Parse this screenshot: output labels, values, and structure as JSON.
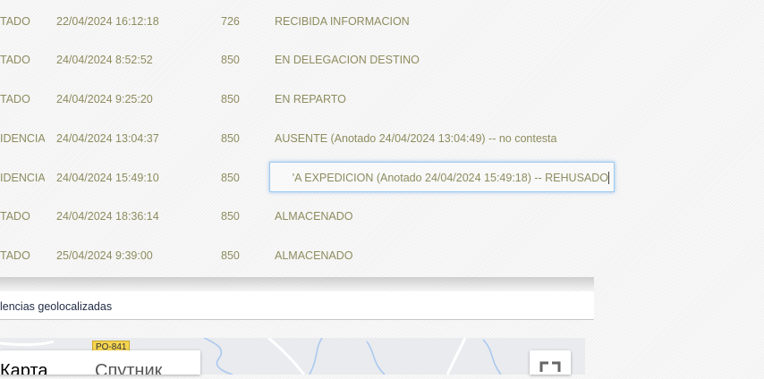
{
  "events": [
    {
      "status": "TADO",
      "date": "22/04/2024 16:12:18",
      "code": "726",
      "description": "RECIBIDA INFORMACION"
    },
    {
      "status": "TADO",
      "date": "24/04/2024 8:52:52",
      "code": "850",
      "description": "EN DELEGACION DESTINO"
    },
    {
      "status": "TADO",
      "date": "24/04/2024 9:25:20",
      "code": "850",
      "description": "EN REPARTO"
    },
    {
      "status": "IDENCIA",
      "date": "24/04/2024 13:04:37",
      "code": "850",
      "description": "AUSENTE (Anotado 24/04/2024 13:04:49) -- no contesta"
    },
    {
      "status": "IDENCIA",
      "date": "24/04/2024 15:49:10",
      "code": "850",
      "description": "'A EXPEDICION (Anotado 24/04/2024 15:49:18) -- REHUSADO"
    },
    {
      "status": "TADO",
      "date": "24/04/2024 18:36:14",
      "code": "850",
      "description": "ALMACENADO"
    },
    {
      "status": "TADO",
      "date": "25/04/2024 9:39:00",
      "code": "850",
      "description": "ALMACENADO"
    }
  ],
  "panel": {
    "title": "lencias geolocalizadas"
  },
  "map": {
    "road_label": "PO-841",
    "type_map_label": "Карта",
    "type_satellite_label": "Спутник"
  }
}
